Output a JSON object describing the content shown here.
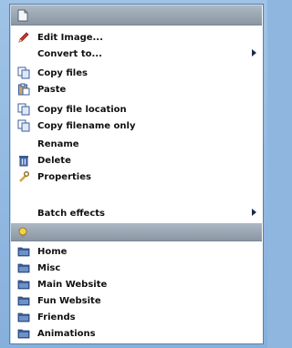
{
  "menu": {
    "header_icon": "file-icon",
    "items": [
      {
        "label": "Edit Image...",
        "icon": "pencil-icon"
      },
      {
        "label": "Convert to...",
        "icon": "",
        "submenu": true
      },
      {
        "label": "Copy files",
        "icon": "copy-files-icon"
      },
      {
        "label": "Paste",
        "icon": "paste-icon"
      },
      {
        "label": "Copy file location",
        "icon": "copy-location-icon"
      },
      {
        "label": "Copy filename only",
        "icon": "copy-filename-icon"
      },
      {
        "label": "Rename",
        "icon": ""
      },
      {
        "label": "Delete",
        "icon": "trash-icon"
      },
      {
        "label": "Properties",
        "icon": "wrench-icon"
      },
      {
        "label": "Batch effects",
        "icon": "",
        "submenu": true
      }
    ],
    "section2": {
      "icon": "folder-lightbulb-icon"
    },
    "folders": [
      {
        "label": "Home",
        "icon": "folder-icon"
      },
      {
        "label": "Misc",
        "icon": "folder-icon"
      },
      {
        "label": "Main Website",
        "icon": "folder-icon"
      },
      {
        "label": "Fun Website",
        "icon": "folder-icon"
      },
      {
        "label": "Friends",
        "icon": "folder-icon"
      },
      {
        "label": "Animations",
        "icon": "folder-icon"
      }
    ]
  },
  "colors": {
    "frame": "#8fb6de",
    "header": "#9aa6b2",
    "text": "#111111",
    "disabled_text": "#c7c9cc",
    "folder_blue": "#3a5f9e",
    "pencil_red": "#c22727"
  }
}
